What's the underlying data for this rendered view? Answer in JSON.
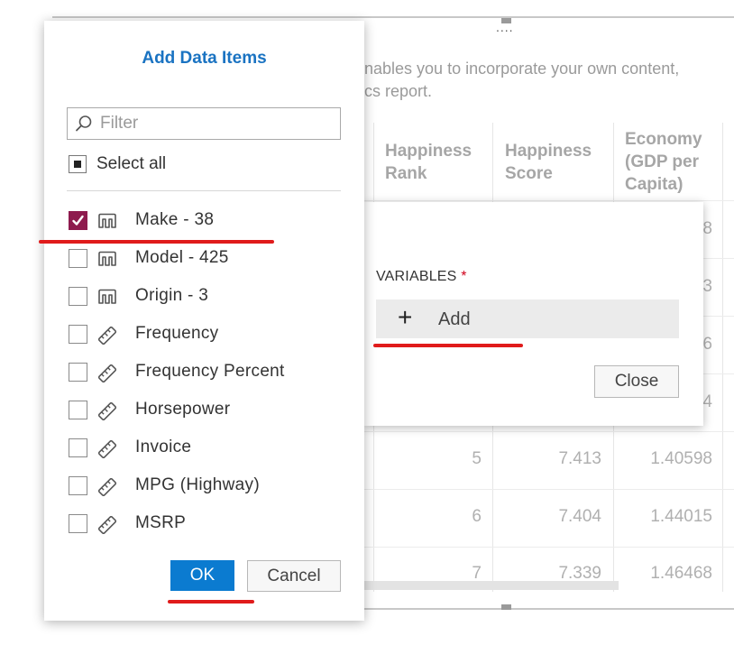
{
  "background": {
    "intro_line1": "nables you to incorporate your own content,",
    "intro_line2": "cs report.",
    "toolbar_dots": "....",
    "columns": [
      {
        "label": "Happiness Rank"
      },
      {
        "label": "Happiness Score"
      },
      {
        "label": "Economy (GDP per Capita)"
      }
    ],
    "partial_cells": [
      "8",
      "3",
      "6",
      "4"
    ],
    "rows": [
      {
        "rank": "5",
        "score": "7.413",
        "economy": "1.40598"
      },
      {
        "rank": "6",
        "score": "7.404",
        "economy": "1.44015"
      },
      {
        "rank": "7",
        "score": "7.339",
        "economy": "1.46468"
      }
    ]
  },
  "variables_popover": {
    "label": "VARIABLES",
    "required_marker": "*",
    "add_label": "Add",
    "close_label": "Close"
  },
  "dialog": {
    "title": "Add Data Items",
    "filter_placeholder": "Filter",
    "select_all_label": "Select all",
    "items": [
      {
        "label": "Make - 38",
        "icon": "category-icon",
        "checked": true
      },
      {
        "label": "Model - 425",
        "icon": "category-icon",
        "checked": false
      },
      {
        "label": "Origin - 3",
        "icon": "category-icon",
        "checked": false
      },
      {
        "label": "Frequency",
        "icon": "measure-icon",
        "checked": false
      },
      {
        "label": "Frequency Percent",
        "icon": "measure-icon",
        "checked": false
      },
      {
        "label": "Horsepower",
        "icon": "measure-icon",
        "checked": false
      },
      {
        "label": "Invoice",
        "icon": "measure-icon",
        "checked": false
      },
      {
        "label": "MPG (Highway)",
        "icon": "measure-icon",
        "checked": false
      },
      {
        "label": "MSRP",
        "icon": "measure-icon",
        "checked": false
      }
    ],
    "ok_label": "OK",
    "cancel_label": "Cancel"
  },
  "colors": {
    "accent_blue": "#0b7bd0",
    "checkbox_checked": "#8e1b4e",
    "annotation_red": "#e01b1b"
  }
}
